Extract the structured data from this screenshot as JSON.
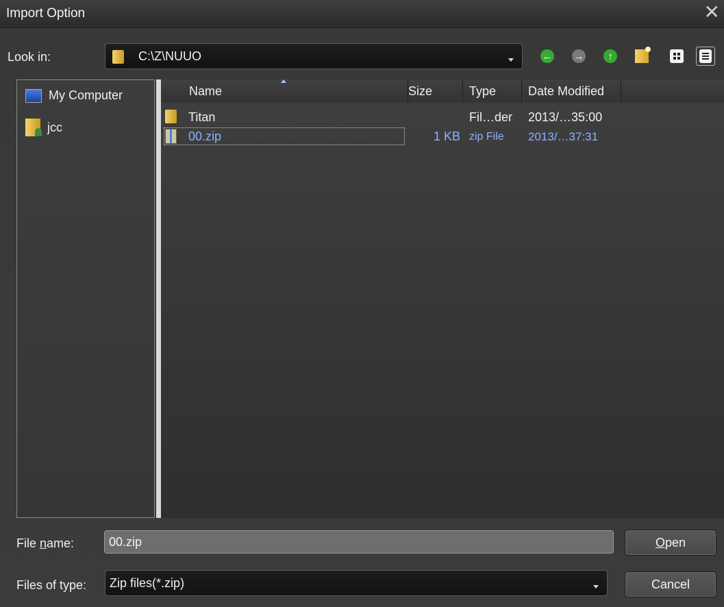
{
  "window": {
    "title": "Import Option"
  },
  "lookin": {
    "label": "Look in:",
    "path": "C:\\Z\\NUUO"
  },
  "toolbar": {
    "back_icon": "back-arrow-icon",
    "forward_icon": "forward-arrow-icon",
    "up_icon": "up-folder-icon",
    "new_folder_icon": "new-folder-icon",
    "list_view_icon": "list-view-icon",
    "details_view_icon": "details-view-icon"
  },
  "places": [
    {
      "label": "My Computer",
      "icon": "computer-icon"
    },
    {
      "label": "jcc",
      "icon": "user-folder-icon"
    }
  ],
  "columns": {
    "name": "Name",
    "size": "Size",
    "type": "Type",
    "modified": "Date Modified"
  },
  "files": [
    {
      "name": "Titan",
      "size": "",
      "type": "Fil…der",
      "modified": "2013/…35:00",
      "icon": "folder-icon"
    },
    {
      "name": "00.zip",
      "size": "1 KB",
      "type": "zip File",
      "modified": "2013/…37:31",
      "icon": "zip-file-icon"
    }
  ],
  "filename": {
    "label_pre": "File ",
    "label_u": "n",
    "label_post": "ame:",
    "value": "00.zip"
  },
  "filetype": {
    "label": "Files of type:",
    "value": "Zip files(*.zip)"
  },
  "buttons": {
    "open_u": "O",
    "open_rest": "pen",
    "cancel": "Cancel"
  },
  "colors": {
    "selected_text": "#8fb0ff",
    "arrow_green": "#3aa832"
  }
}
